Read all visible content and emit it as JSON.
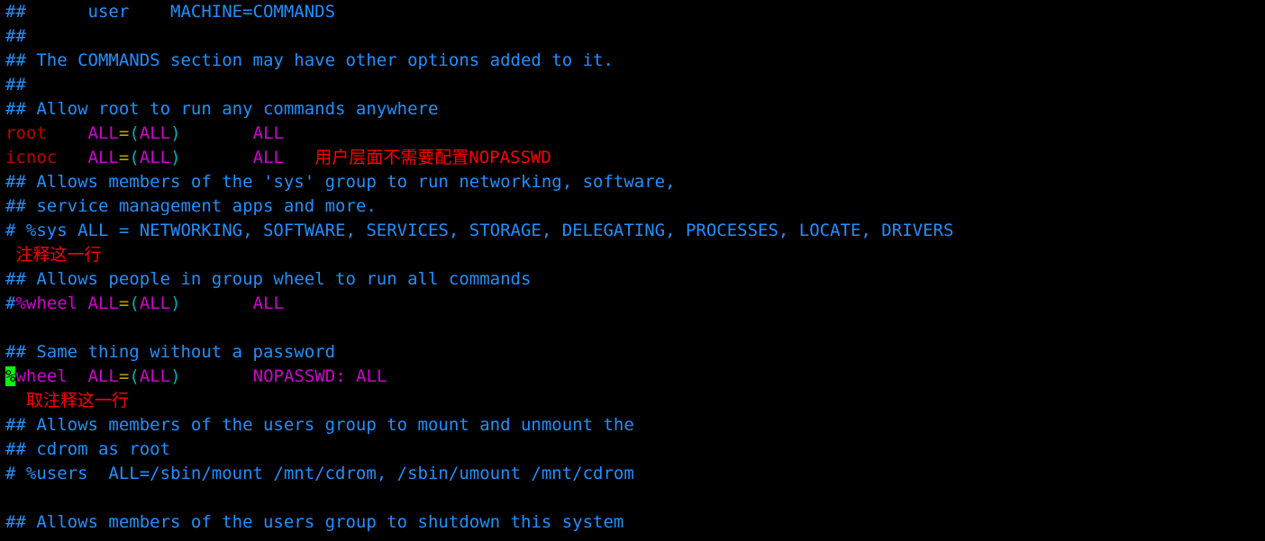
{
  "l1": {
    "a": "##",
    "b": "      user    MACHINE=COMMANDS"
  },
  "l2": "##",
  "l3": "## The COMMANDS section may have other options added to it.",
  "l4": "##",
  "l5": "## Allow root to run any commands anywhere",
  "l6": {
    "user": "root",
    "sp1": "    ",
    "all1": "ALL",
    "eq": "=",
    "op": "(",
    "all2": "ALL",
    "cp": ")",
    "sp2": "       ",
    "all3": "ALL"
  },
  "l7": {
    "user": "icnoc",
    "sp1": "   ",
    "all1": "ALL",
    "eq": "=",
    "op": "(",
    "all2": "ALL",
    "cp": ")",
    "sp2": "       ",
    "all3": "ALL",
    "annsp": "   ",
    "ann": "用户层面不需要配置NOPASSWD"
  },
  "l8": "## Allows members of the 'sys' group to run networking, software,",
  "l9": "## service management apps and more.",
  "l10": "# %sys ALL = NETWORKING, SOFTWARE, SERVICES, STORAGE, DELEGATING, PROCESSES, LOCATE, DRIVERS",
  "l11": {
    "sp": " ",
    "ann": "注释这一行"
  },
  "l12": "## Allows people in group wheel to run all commands",
  "l13": {
    "hash": "#",
    "grp": "%wheel ",
    "all1": "ALL",
    "eq": "=",
    "op": "(",
    "all2": "ALL",
    "cp": ")",
    "sp": "       ",
    "all3": "ALL"
  },
  "l14": "",
  "l15": "## Same thing without a password",
  "l16": {
    "cur": "%",
    "grp": "wheel  ",
    "all1": "ALL",
    "eq": "=",
    "op": "(",
    "all2": "ALL",
    "cp": ")",
    "sp": "       ",
    "np": "NOPASSWD: ALL"
  },
  "l17": {
    "sp": "  ",
    "ann": "取注释这一行"
  },
  "l18": "## Allows members of the users group to mount and unmount the",
  "l19": "## cdrom as root",
  "l20": "# %users  ALL=/sbin/mount /mnt/cdrom, /sbin/umount /mnt/cdrom",
  "l21": "",
  "l22": "## Allows members of the users group to shutdown this system"
}
